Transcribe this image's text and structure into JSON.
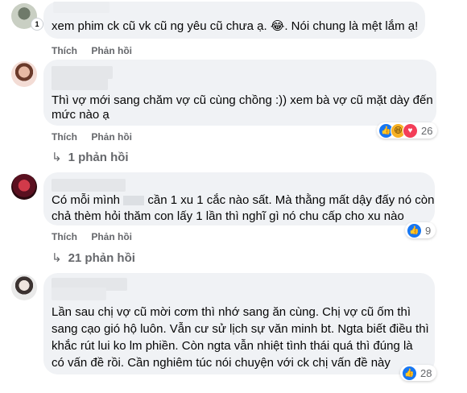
{
  "comments": [
    {
      "text": "xem phim ck cũ vk cũ ng yêu cũ chưa ạ. 😂. Nói chung là mệt lắm ạ!",
      "avatar_badge": "1",
      "actions": {
        "like": "Thích",
        "reply": "Phản hồi"
      }
    },
    {
      "text_line1": "Thì vợ mới sang chăm vợ cũ cùng chồng :)) xem bà vợ cũ mặt dày đến",
      "text_line2": "mức nào ạ",
      "actions": {
        "like": "Thích",
        "reply": "Phản hồi"
      },
      "reaction_count": "26",
      "reply_link": "1 phản hồi"
    },
    {
      "text_line1a": "Có mỗi mình",
      "text_line1b": "cần 1 xu 1 cắc nào sất. Mà thằng mất dậy đấy nó còn",
      "text_line2": "chả thèm hỏi thăm con lấy 1 lần thì nghĩ gì nó chu cấp cho xu nào",
      "actions": {
        "like": "Thích",
        "reply": "Phản hồi"
      },
      "reaction_count": "9",
      "reply_link": "21 phản hồi"
    },
    {
      "text_line1": "Lần sau chị vợ cũ mời cơm thì nhớ sang ăn cùng. Chị vợ cũ ốm thì",
      "text_line2": "sang cạo gió hộ luôn. Vẫn cư sử lịch sự văn minh bt. Ngta biết điều thì",
      "text_line3": "khắc rút lui ko lm phiền. Còn ngta vẫn nhiệt tình thái quá thì đúng là",
      "text_line4": "có vấn đề rồi. Cần nghiêm túc nói chuyện với ck chị vấn đề này",
      "reaction_count": "28"
    }
  ],
  "icons": {
    "like": "like-icon",
    "haha": "haha-icon",
    "love": "heart-icon",
    "reply_arrow": "reply-arrow-icon"
  },
  "colors": {
    "bubble": "#f0f2f5",
    "meta_text": "#65676b",
    "like_blue": "#1877f2",
    "love_red": "#f33e58",
    "haha_yellow": "#f7b125"
  }
}
